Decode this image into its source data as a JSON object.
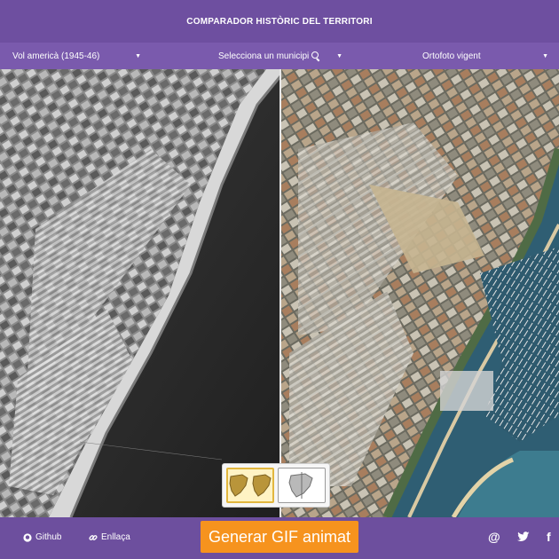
{
  "header": {
    "title": "COMPARADOR HISTÒRIC DEL TERRITORI"
  },
  "selectors": {
    "left": {
      "selected": "Vol americà (1945-46)"
    },
    "middle": {
      "selected": "Selecciona un municipi"
    },
    "right": {
      "selected": "Ortofoto vigent"
    }
  },
  "layout_switch": {
    "options": [
      "split-view",
      "side-by-side-view"
    ],
    "active": "split-view"
  },
  "footer": {
    "github_label": "Github",
    "link_label": "Enllaça",
    "gif_button_label": "Generar GIF animat",
    "social": {
      "email": "@",
      "twitter": "twitter-icon",
      "facebook": "f"
    }
  },
  "colors": {
    "header": "#6e4fa0",
    "selector_bar": "#7a5aad",
    "gif_button": "#f6931e",
    "active_view": "#e2b73e"
  }
}
